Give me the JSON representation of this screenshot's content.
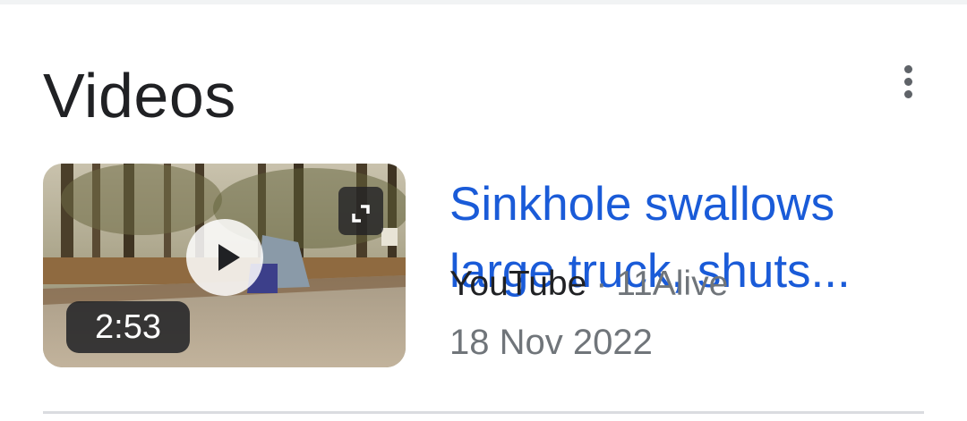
{
  "section": {
    "title": "Videos",
    "more_icon": "more-vert-icon"
  },
  "video": {
    "title": "Sinkhole swallows large truck, shuts...",
    "duration": "2:53",
    "source": "YouTube",
    "separator": "·",
    "channel": "11Alive",
    "date": "18 Nov 2022",
    "play_icon": "play-icon",
    "expand_icon": "expand-icon"
  },
  "colors": {
    "title_link": "#1a5bd8",
    "meta_gray": "#70757a",
    "heading": "#202124"
  }
}
